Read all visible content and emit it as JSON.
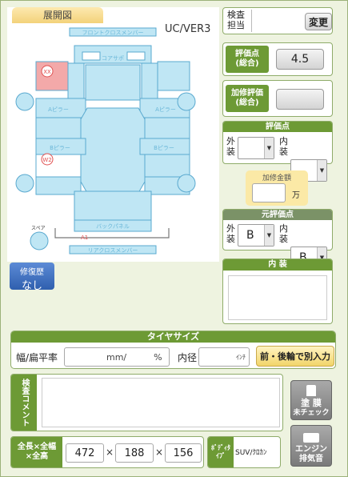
{
  "diagram": {
    "tab_label": "展開図",
    "version": "UC/VER3",
    "parts": {
      "front_cross_member": "フロントクロスメンバー",
      "core_support": "コアサポ",
      "a_pillar_left": "Aピラー",
      "a_pillar_right": "Aピラー",
      "b_pillar_left": "Bピラー",
      "b_pillar_right": "Bピラー",
      "back_panel": "バックパネル",
      "rear_cross_member": "リアクロスメンバー",
      "spare": "スペア"
    },
    "marks": [
      {
        "code": "XX"
      },
      {
        "code": "W2"
      },
      {
        "code": "A1"
      }
    ]
  },
  "repair_history": {
    "label": "修復歴",
    "value": "なし"
  },
  "inspector": {
    "label_line1": "検査",
    "label_line2": "担当",
    "change_button": "変更"
  },
  "rating": {
    "label_line1": "評価点",
    "label_line2": "(総合)",
    "value": "4.5"
  },
  "modified_rating": {
    "label_line1": "加修評価",
    "label_line2": "(総合)",
    "value": ""
  },
  "score": {
    "header": "評価点",
    "exterior_label_1": "外",
    "exterior_label_2": "装",
    "interior_label_1": "内",
    "interior_label_2": "装",
    "exterior_value": "",
    "interior_value": ""
  },
  "repair_amount": {
    "label": "加修金額",
    "value": "",
    "unit": "万"
  },
  "original_score": {
    "header": "元評価点",
    "exterior_label_1": "外",
    "exterior_label_2": "装",
    "interior_label_1": "内",
    "interior_label_2": "装",
    "exterior_value": "B",
    "interior_value": "B"
  },
  "interior_notes": {
    "header": "内 装",
    "value": ""
  },
  "tire": {
    "header": "タイヤサイズ",
    "width_label": "幅/扁平率",
    "width_unit": "mm/",
    "ratio_unit": "%",
    "diameter_label": "内径",
    "diameter_unit": "ｲﾝﾁ",
    "separate_button": "前・後輪で別入力"
  },
  "comment": {
    "label": "検査コメント",
    "value": ""
  },
  "dimensions": {
    "label_line1": "全長×全幅",
    "label_line2": "×全高",
    "length": "472",
    "width": "188",
    "height": "156",
    "times": "×"
  },
  "body_type": {
    "label_line1": "ﾎﾞﾃﾞｨﾀ",
    "label_line2": "ｲﾌﾟ",
    "value": "SUV/ｸﾛｶﾝ"
  },
  "buttons": {
    "paint_unchecked_line1": "塗 膜",
    "paint_unchecked_line2": "未チェック",
    "engine_sound_line1": "エンジン",
    "engine_sound_line2": "排気音"
  }
}
